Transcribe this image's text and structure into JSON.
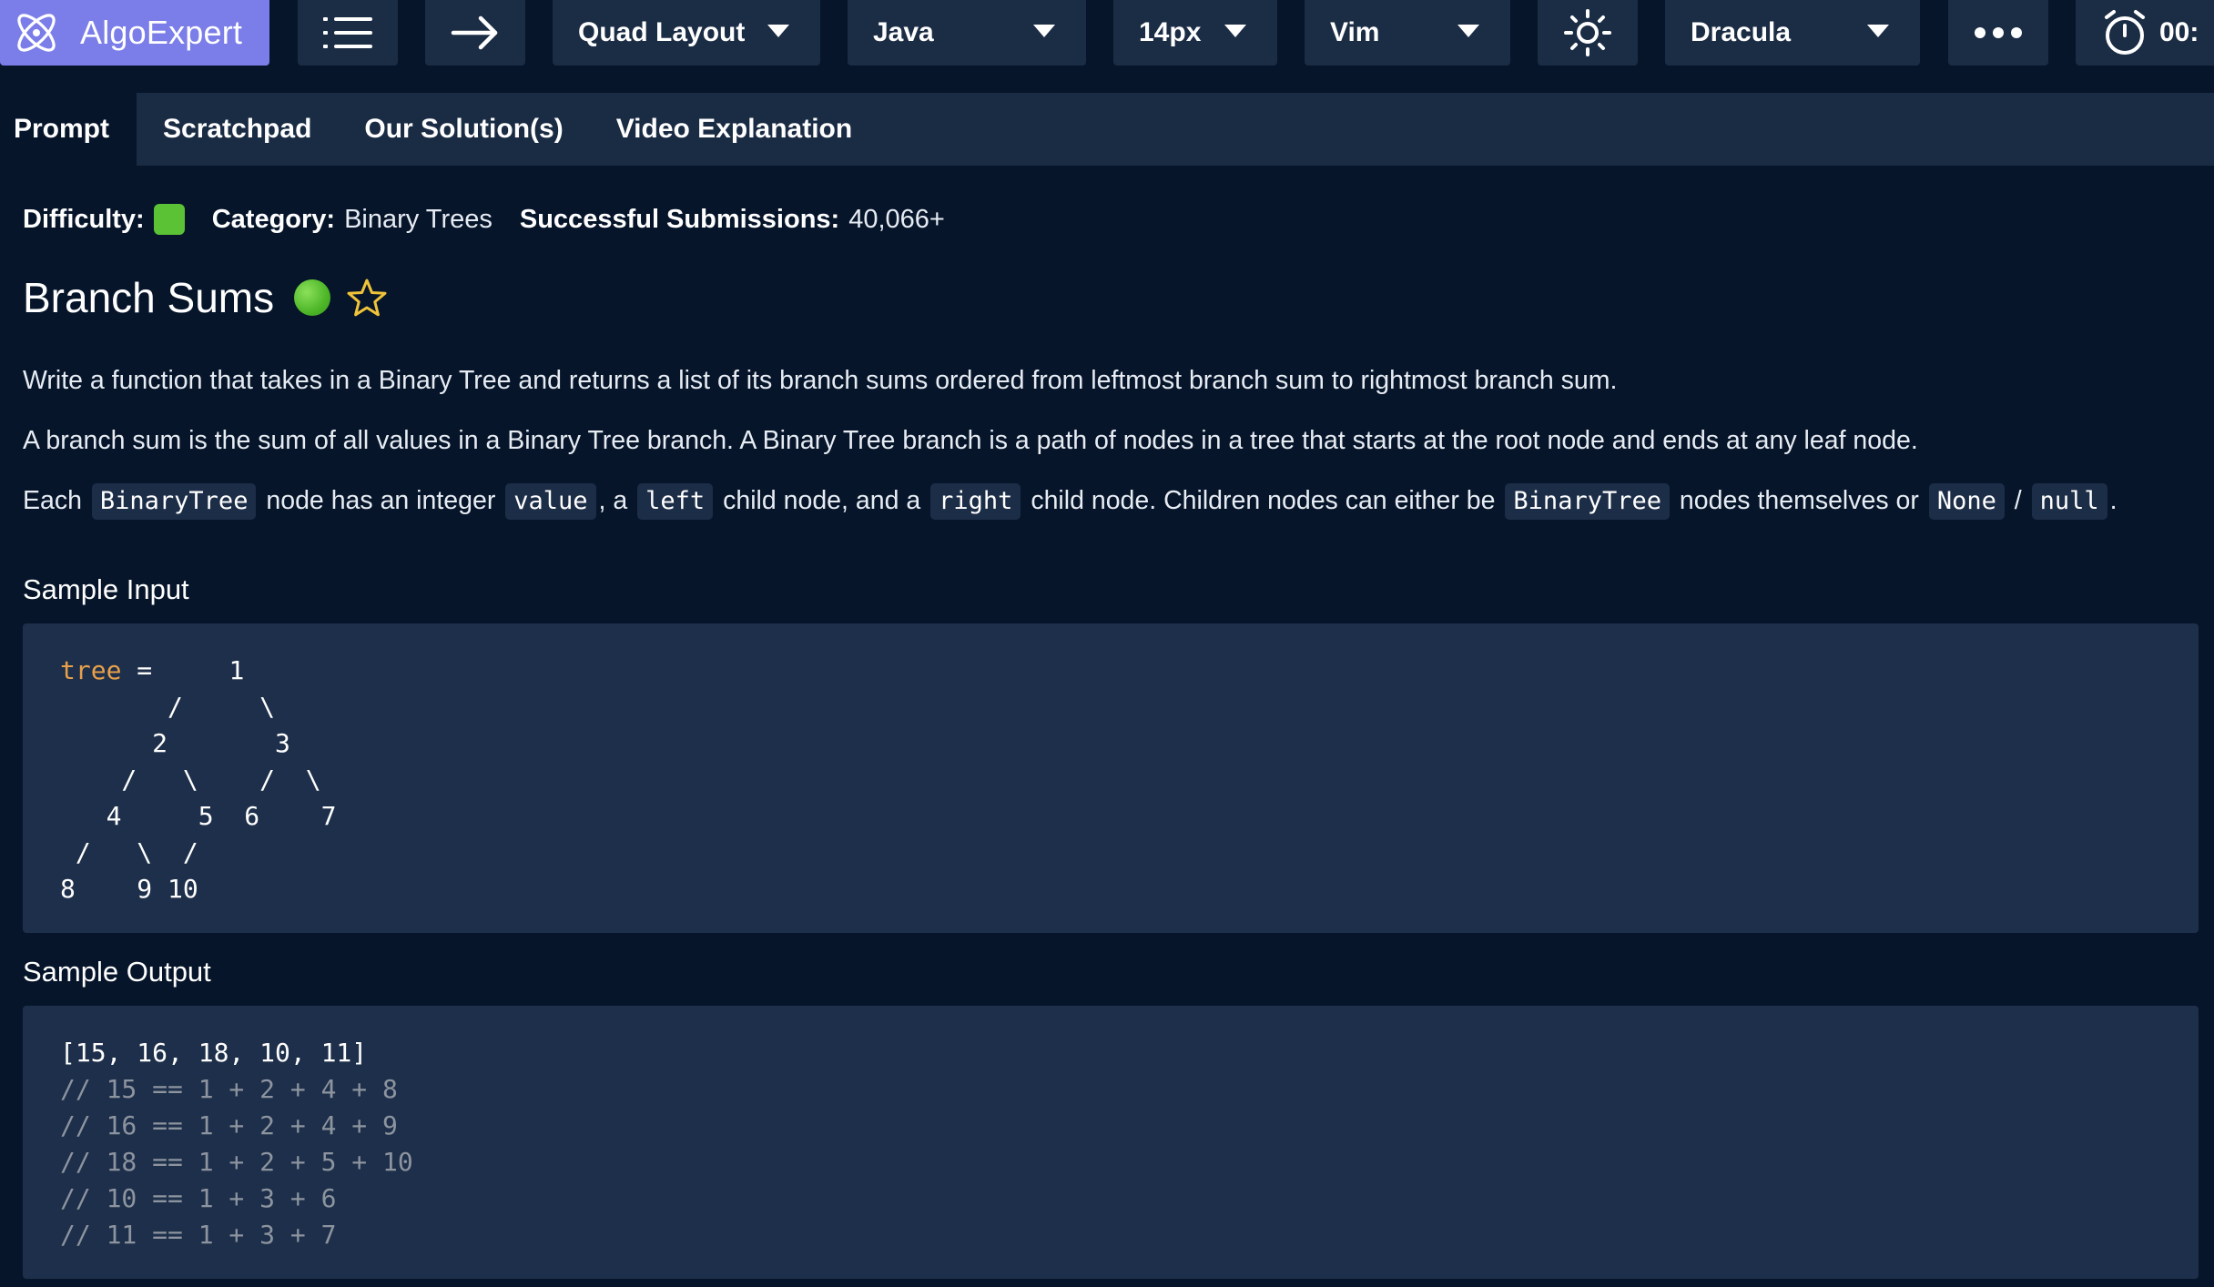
{
  "toolbar": {
    "logo_text": "AlgoExpert",
    "layout_label": "Quad Layout",
    "language_label": "Java",
    "font_size_label": "14px",
    "keymap_label": "Vim",
    "theme_label": "Dracula",
    "timer_text": "00:"
  },
  "tabs": [
    {
      "label": "Prompt",
      "active": true
    },
    {
      "label": "Scratchpad",
      "active": false
    },
    {
      "label": "Our Solution(s)",
      "active": false
    },
    {
      "label": "Video Explanation",
      "active": false
    }
  ],
  "meta": {
    "difficulty_label": "Difficulty:",
    "category_label": "Category:",
    "category_value": "Binary Trees",
    "submissions_label": "Successful Submissions:",
    "submissions_value": "40,066+"
  },
  "problem": {
    "title": "Branch Sums",
    "para1": "Write a function that takes in a Binary Tree and returns a list of its branch sums ordered from leftmost branch sum to rightmost branch sum.",
    "para2": "A branch sum is the sum of all values in a Binary Tree branch. A Binary Tree branch is a path of nodes in a tree that starts at the root node and ends at any leaf node.",
    "para3": {
      "t1": "Each",
      "c1": "BinaryTree",
      "t2": "node has an integer",
      "c2": "value",
      "t3": ", a",
      "c3": "left",
      "t4": "child node, and a",
      "c4": "right",
      "t5": "child node. Children nodes can either be",
      "c5": "BinaryTree",
      "t6": "nodes themselves or",
      "c6": "None",
      "t7": "/",
      "c7": "null",
      "t8": "."
    }
  },
  "sample_input": {
    "title": "Sample Input",
    "keyword": "tree",
    "lines": [
      " =     1",
      "       /     \\",
      "      2       3",
      "    /   \\    /  \\",
      "   4     5  6    7",
      " /   \\  /",
      "8    9 10"
    ]
  },
  "sample_output": {
    "title": "Sample Output",
    "result": "[15, 16, 18, 10, 11]",
    "comments": [
      "// 15 == 1 + 2 + 4 + 8",
      "// 16 == 1 + 2 + 4 + 9",
      "// 18 == 1 + 2 + 5 + 10",
      "// 10 == 1 + 3 + 6",
      "// 11 == 1 + 3 + 7"
    ]
  },
  "colors": {
    "logo_bg": "#7b7ee8",
    "difficulty_easy": "#5bc236",
    "keyword": "#e8a04b",
    "comment": "#8d949f",
    "star": "#f0c43a"
  },
  "icons": {
    "logo": "algoexpert-logo-icon",
    "menu": "list-icon",
    "next": "arrow-right-icon",
    "theme_toggle": "sun-icon",
    "more": "more-dots-icon",
    "timer": "stopwatch-icon"
  }
}
